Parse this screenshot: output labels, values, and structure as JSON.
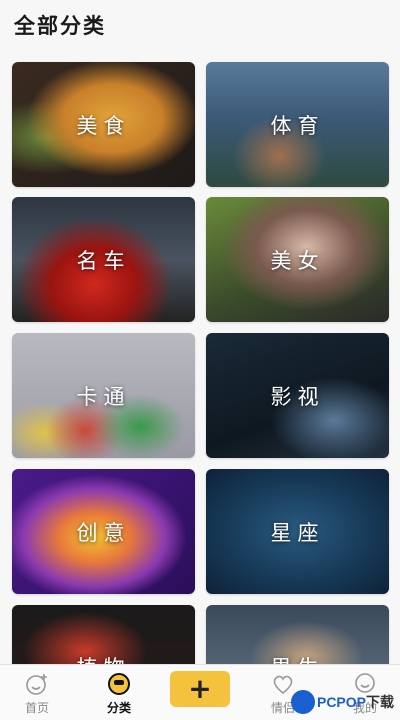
{
  "header": {
    "title": "全部分类"
  },
  "categories": [
    {
      "label": "美食",
      "theme": "food"
    },
    {
      "label": "体育",
      "theme": "sport"
    },
    {
      "label": "名车",
      "theme": "car"
    },
    {
      "label": "美女",
      "theme": "beauty"
    },
    {
      "label": "卡通",
      "theme": "cartoon"
    },
    {
      "label": "影视",
      "theme": "movie"
    },
    {
      "label": "创意",
      "theme": "creative"
    },
    {
      "label": "星座",
      "theme": "star"
    },
    {
      "label": "植物",
      "theme": "plant"
    },
    {
      "label": "男生",
      "theme": "boys"
    }
  ],
  "tabbar": {
    "home": {
      "label": "首页",
      "icon": "smile-face-icon"
    },
    "category": {
      "label": "分类",
      "icon": "category-face-icon"
    },
    "add": {
      "label": "+",
      "icon": "plus-icon",
      "color": "#f5c23d"
    },
    "favorite": {
      "label": "情侣",
      "icon": "heart-icon"
    },
    "mine": {
      "label": "我的",
      "icon": "user-icon"
    }
  },
  "watermark": {
    "part_a": "PCPOP",
    "part_b": "下载"
  }
}
